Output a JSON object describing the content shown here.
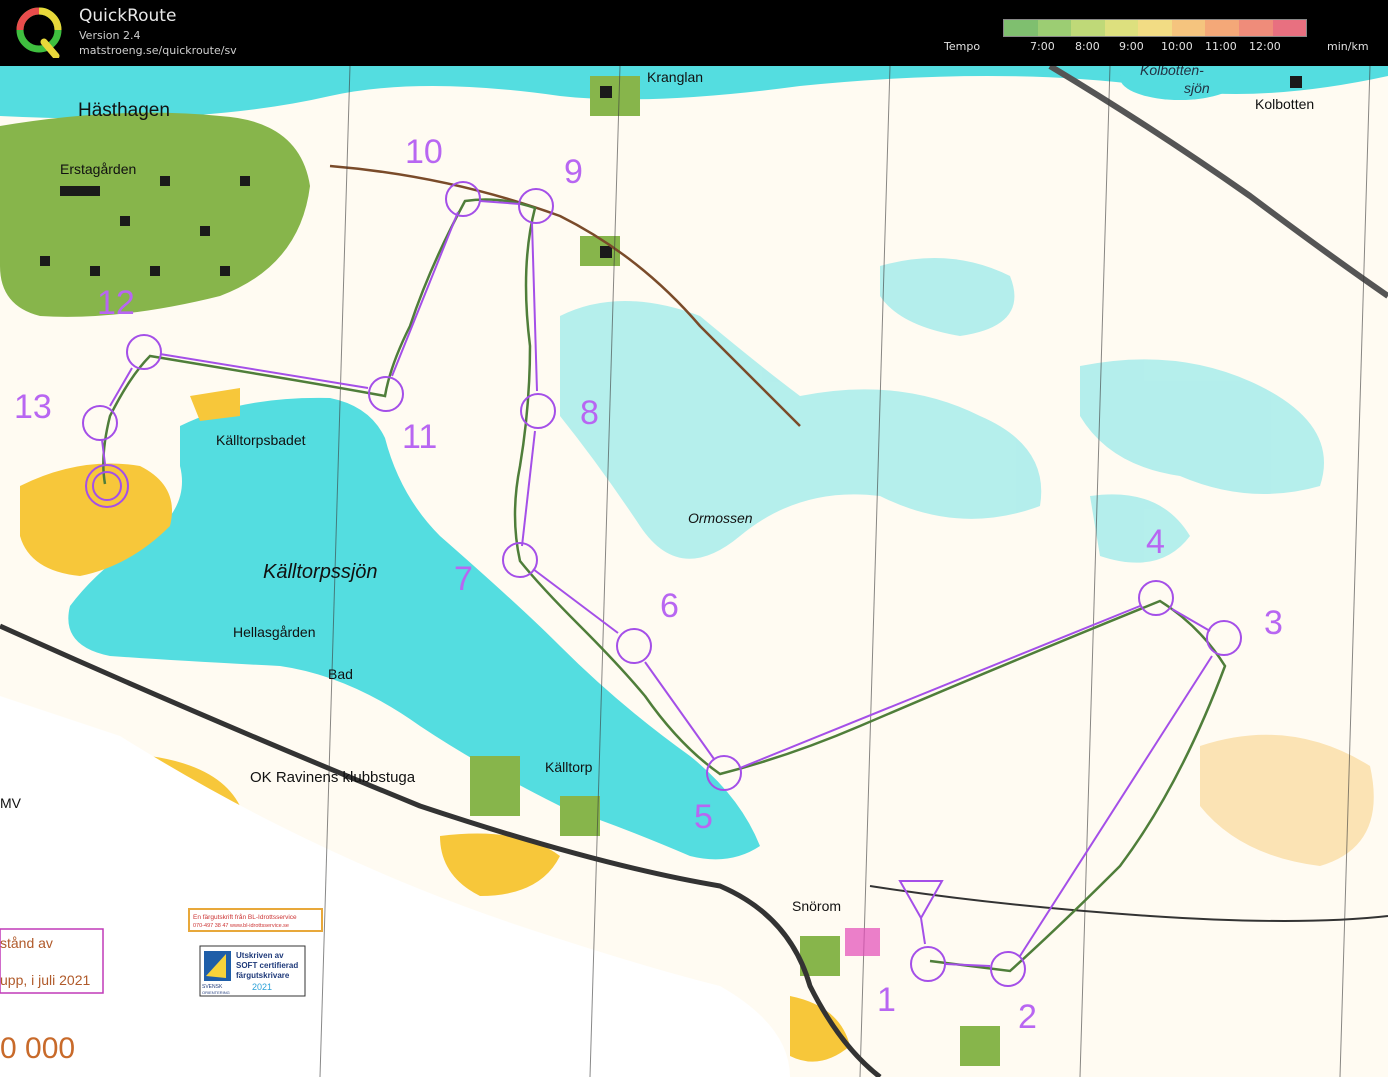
{
  "app": {
    "title": "QuickRoute",
    "version": "Version 2.4",
    "url": "matstroeng.se/quickroute/sv"
  },
  "tempo": {
    "label": "Tempo",
    "ticks": [
      "7:00",
      "8:00",
      "9:00",
      "10:00",
      "11:00",
      "12:00"
    ],
    "unit": "min/km",
    "gradient": [
      "#7fbf6f",
      "#9ccd73",
      "#bfd978",
      "#dde07e",
      "#f2dc84",
      "#f5c47e",
      "#f4a878",
      "#ef8c7a",
      "#e87080"
    ]
  },
  "map": {
    "colors": {
      "water": "#54dde0",
      "open": "#f7c73a",
      "forest": "#ffffff",
      "green": "#87b54b",
      "course": "#a44fe8",
      "route": "#4f7e3a"
    },
    "place_names": {
      "hasthagen": "Hästhagen",
      "erstagarden": "Erstagården",
      "kranglan": "Kranglan",
      "kolbottensjon1": "Kolbotten-",
      "kolbottensjon2": "sjön",
      "kolbotten": "Kolbotten",
      "kalltorpsbadet": "Källtorpsbadet",
      "kalltorpssjon": "Källtorpssjön",
      "hellasgarden": "Hellasgården",
      "bad": "Bad",
      "ok_ravinen": "OK Ravinens klubbstuga",
      "kalltorp": "Källtorp",
      "ormossen": "Ormossen",
      "snorom": "Snörom",
      "mv": "MV"
    },
    "controls": [
      "1",
      "2",
      "3",
      "4",
      "5",
      "6",
      "7",
      "8",
      "9",
      "10",
      "11",
      "12",
      "13"
    ],
    "legend": {
      "print_line1": "En färgutskrift från BL-Idrottsservice",
      "print_line2": "070-497 38 47        www.bl-idrottsservice.se",
      "soft_line1": "Utskriven av",
      "soft_line2": "SOFT certifierad",
      "soft_line3": "färgutskrivare",
      "soft_year": "2021",
      "svensk": "SVENSK",
      "orient": "ORIENTERING",
      "box_line1": "stånd av",
      "box_line2": "upp, i juli 2021",
      "scale": "0 000"
    }
  }
}
